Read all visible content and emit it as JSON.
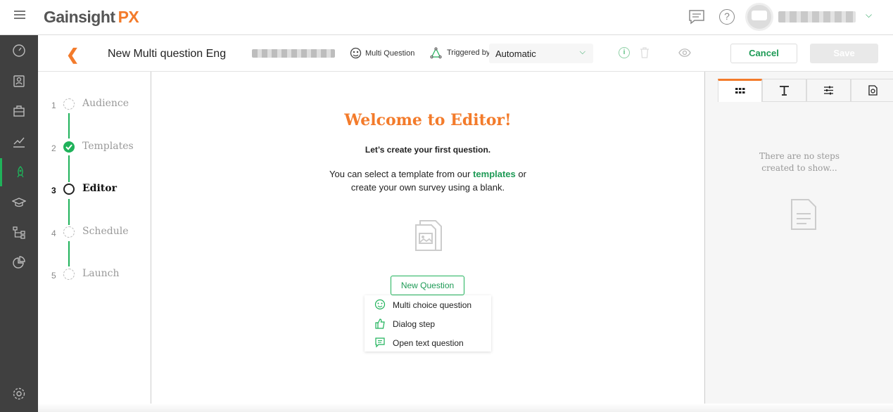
{
  "topbar": {
    "logo_main": "Gainsight",
    "logo_accent": "PX",
    "icons": [
      "menu-icon",
      "chat-icon",
      "help-icon",
      "avatar-icon"
    ]
  },
  "leftnav": {
    "items": [
      "dashboard-icon",
      "people-icon",
      "briefcase-icon",
      "analytics-icon",
      "rocket-icon",
      "graduation-cap-icon",
      "hierarchy-icon",
      "pie-chart-icon",
      "settings-icon"
    ],
    "active": "rocket-icon"
  },
  "subheader": {
    "title": "New Multi question Eng",
    "type_label": "Multi Question",
    "triggered_label": "Triggered by",
    "trigger_value": "Automatic",
    "cancel_label": "Cancel",
    "save_label": "Save"
  },
  "steps": [
    {
      "num": "1",
      "label": "Audience",
      "state": "pending"
    },
    {
      "num": "2",
      "label": "Templates",
      "state": "done"
    },
    {
      "num": "3",
      "label": "Editor",
      "state": "current"
    },
    {
      "num": "4",
      "label": "Schedule",
      "state": "pending"
    },
    {
      "num": "5",
      "label": "Launch",
      "state": "pending"
    }
  ],
  "main": {
    "welcome": "Welcome to Editor!",
    "sub1": "Let’s create your first question.",
    "sub2_pre": "You can select a template from our",
    "sub2_link": "templates",
    "sub2_post": "or",
    "sub2_line2": "create your own survey using a blank.",
    "new_question_label": "New Question",
    "menu": [
      {
        "label": "Multi choice question",
        "icon": "multi-choice-icon"
      },
      {
        "label": "Dialog step",
        "icon": "thumbs-up-icon"
      },
      {
        "label": "Open text question",
        "icon": "comment-icon"
      }
    ]
  },
  "right": {
    "tabs": [
      "grid-icon",
      "text-icon",
      "sliders-icon",
      "settings-doc-icon"
    ],
    "empty_line1": "There are no steps",
    "empty_line2": "created to show..."
  },
  "colors": {
    "accent_orange": "#f37b2b",
    "accent_green": "#1fb25a",
    "nav_bg": "#404040"
  }
}
